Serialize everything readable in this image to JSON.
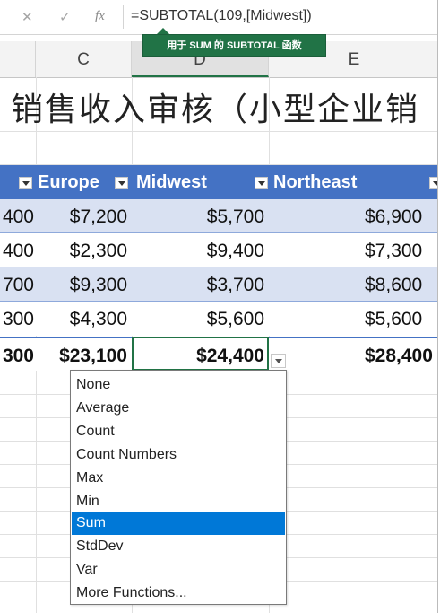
{
  "formula_bar": {
    "cancel_icon": "✕",
    "enter_icon": "✓",
    "fx_label": "fx",
    "formula": "=SUBTOTAL(109,[Midwest])"
  },
  "tooltip": "用于 SUM 的 SUBTOTAL 函数",
  "columns": [
    "C",
    "D",
    "E"
  ],
  "title": "销售收入审核（小型企业销",
  "table": {
    "headers": [
      "Europe",
      "Midwest",
      "Northeast"
    ],
    "rows": [
      [
        "400",
        "$7,200",
        "$5,700",
        "$6,900"
      ],
      [
        "400",
        "$2,300",
        "$9,400",
        "$7,300"
      ],
      [
        "700",
        "$9,300",
        "$3,700",
        "$8,600"
      ],
      [
        "300",
        "$4,300",
        "$5,600",
        "$5,600"
      ]
    ],
    "total": [
      "300",
      "$23,100",
      "$24,400",
      "$28,400"
    ]
  },
  "dropdown": {
    "options": [
      "None",
      "Average",
      "Count",
      "Count Numbers",
      "Max",
      "Min",
      "Sum",
      "StdDev",
      "Var",
      "More Functions..."
    ],
    "selected": "Sum"
  },
  "colors": {
    "table_header": "#4472c4",
    "band": "#d9e1f2",
    "tooltip": "#217346",
    "selection": "#0078d7"
  }
}
